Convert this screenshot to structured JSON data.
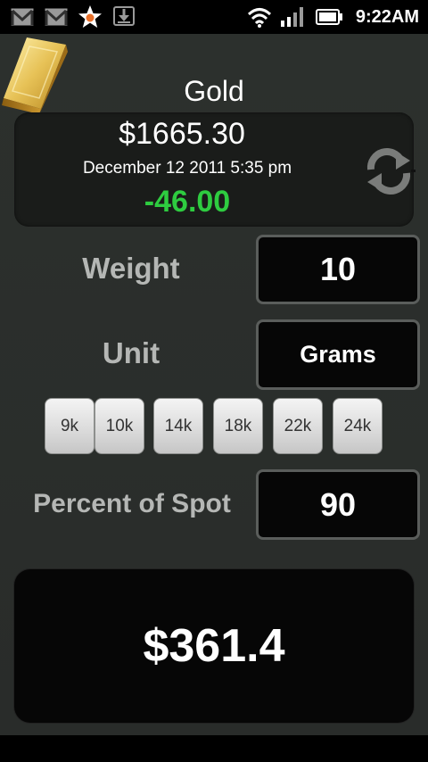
{
  "status_bar": {
    "time": "9:22AM",
    "icons": [
      "gmail-icon",
      "gmail-icon",
      "star-notification-icon",
      "download-icon",
      "wifi-icon",
      "signal-icon",
      "battery-icon"
    ]
  },
  "header": {
    "title": "Gold",
    "logo_icon": "gold-bar-icon"
  },
  "price": {
    "spot": "$1665.30",
    "timestamp": "December 12 2011 5:35 pm",
    "change": "-46.00",
    "change_color": "#2ecc40",
    "refresh_icon": "refresh-arrows-icon"
  },
  "weight": {
    "label": "Weight",
    "value": "10"
  },
  "unit": {
    "label": "Unit",
    "value": "Grams"
  },
  "karats": [
    "9k",
    "10k",
    "14k",
    "18k",
    "22k",
    "24k"
  ],
  "percent": {
    "label": "Percent of Spot",
    "value": "90"
  },
  "result": {
    "value": "$361.4"
  }
}
